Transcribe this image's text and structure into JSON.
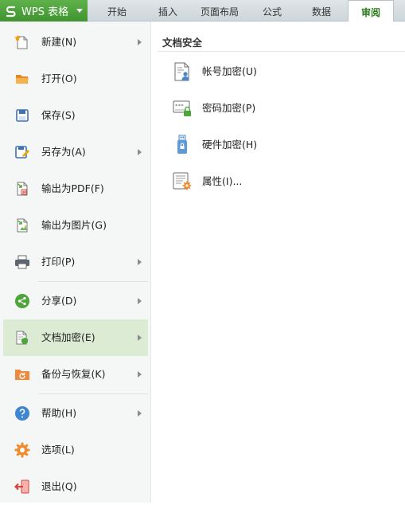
{
  "app": {
    "menu_button_label": "WPS 表格",
    "accent_color": "#4ea53b"
  },
  "ribbon_tabs": [
    {
      "label": "开始",
      "active": false
    },
    {
      "label": "插入",
      "active": false
    },
    {
      "label": "页面布局",
      "active": false
    },
    {
      "label": "公式",
      "active": false
    },
    {
      "label": "数据",
      "active": false
    },
    {
      "label": "审阅",
      "active": true
    }
  ],
  "menu": {
    "items": [
      {
        "label": "新建(N)",
        "icon": "new-document-icon",
        "has_submenu": true
      },
      {
        "label": "打开(O)",
        "icon": "open-folder-icon",
        "has_submenu": false
      },
      {
        "label": "保存(S)",
        "icon": "save-icon",
        "has_submenu": false
      },
      {
        "label": "另存为(A)",
        "icon": "save-as-icon",
        "has_submenu": true
      },
      {
        "label": "输出为PDF(F)",
        "icon": "export-pdf-icon",
        "has_submenu": false
      },
      {
        "label": "输出为图片(G)",
        "icon": "export-image-icon",
        "has_submenu": false
      },
      {
        "label": "打印(P)",
        "icon": "printer-icon",
        "has_submenu": true
      },
      {
        "label": "分享(D)",
        "icon": "share-icon",
        "has_submenu": true
      },
      {
        "label": "文档加密(E)",
        "icon": "document-lock-icon",
        "has_submenu": true,
        "selected": true
      },
      {
        "label": "备份与恢复(K)",
        "icon": "backup-restore-icon",
        "has_submenu": true
      },
      {
        "label": "帮助(H)",
        "icon": "help-icon",
        "has_submenu": true
      },
      {
        "label": "选项(L)",
        "icon": "gear-icon",
        "has_submenu": false
      },
      {
        "label": "退出(Q)",
        "icon": "exit-icon",
        "has_submenu": false
      }
    ]
  },
  "panel": {
    "title": "文档安全",
    "items": [
      {
        "label": "帐号加密(U)",
        "icon": "account-encrypt-icon"
      },
      {
        "label": "密码加密(P)",
        "icon": "password-encrypt-icon"
      },
      {
        "label": "硬件加密(H)",
        "icon": "usb-encrypt-icon"
      },
      {
        "label": "属性(I)...",
        "icon": "properties-icon"
      }
    ]
  }
}
